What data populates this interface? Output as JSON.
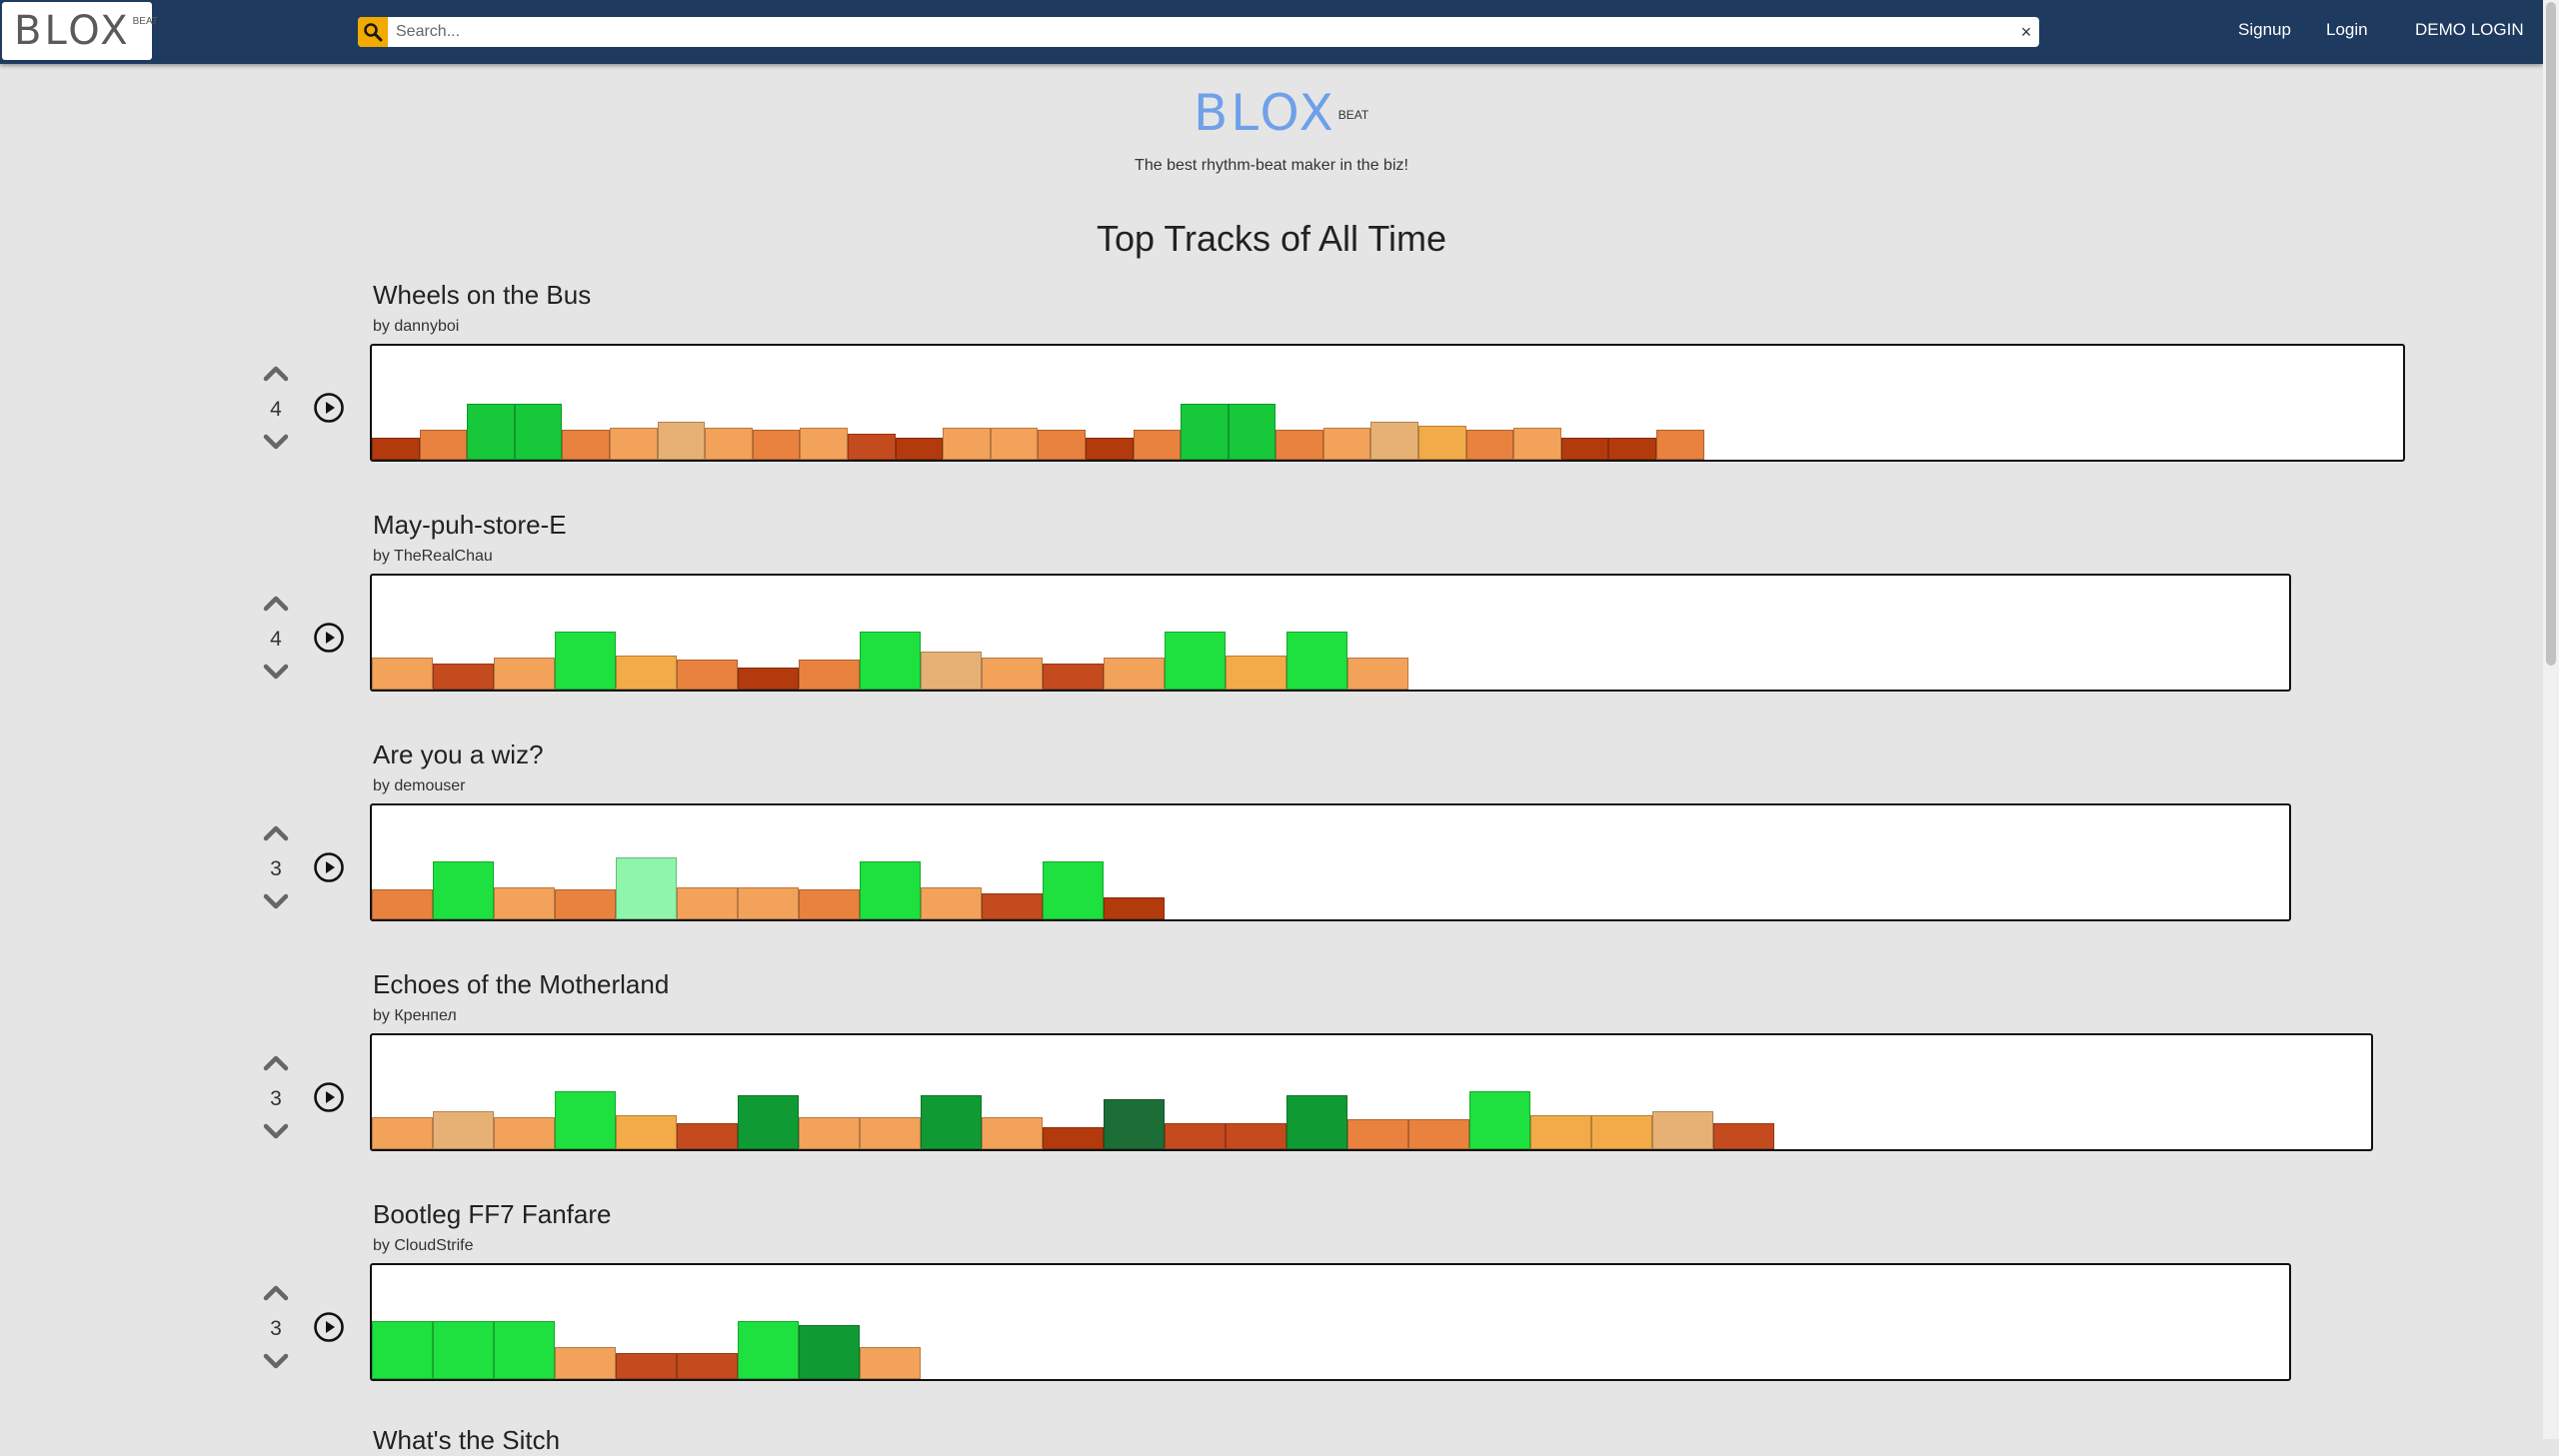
{
  "navbar": {
    "logo_text": "BLOX",
    "logo_sup": "BEAT",
    "search_placeholder": "Search...",
    "search_value": "",
    "clear_label": "×",
    "links": [
      "Signup",
      "Login",
      "DEMO LOGIN"
    ],
    "accent_color": "#f2a900",
    "bar_color": "#1f3a5f"
  },
  "hero": {
    "logo_text": "BLOX",
    "logo_sup": "BEAT",
    "tagline": "The best rhythm-beat maker in the biz!",
    "logo_color": "#6fa0e8"
  },
  "page_title": "Top Tracks of All Time",
  "palette": {
    "r": "#b33a0c",
    "rr": "#c44b1e",
    "o": "#e9823e",
    "l": "#f3a25a",
    "y": "#f2ab48",
    "t": "#e7b175",
    "g": "#17c93a",
    "G": "#1ee03e",
    "d": "#1c6e36",
    "m": "#109a33",
    "p": "#8ef5aa"
  },
  "tracks": [
    {
      "title": "Wheels on the Bus",
      "author": "by dannyboi",
      "votes": "4",
      "blocks": [
        "r",
        "o",
        "g",
        "g",
        "o",
        "l",
        "t",
        "l",
        "o",
        "l",
        "rr",
        "r",
        "l",
        "l",
        "o",
        "r",
        "o",
        "g",
        "g",
        "o",
        "l",
        "t",
        "y",
        "o",
        "l",
        "r",
        "r",
        "o"
      ]
    },
    {
      "title": "May-puh-store-E",
      "author": "by TheRealChau",
      "votes": "4",
      "blocks": [
        "l",
        "rr",
        "l",
        "G",
        "y",
        "o",
        "r",
        "o",
        "G",
        "t",
        "l",
        "rr",
        "l",
        "G",
        "y",
        "G",
        "l"
      ]
    },
    {
      "title": "Are you a wiz?",
      "author": "by demouser",
      "votes": "3",
      "blocks": [
        "o",
        "G",
        "l",
        "o",
        "p",
        "l",
        "l",
        "o",
        "G",
        "l",
        "rr",
        "G",
        "r"
      ]
    },
    {
      "title": "Echoes of the Motherland",
      "author": "by Кренпел",
      "votes": "3",
      "blocks": [
        "l",
        "t",
        "l",
        "G",
        "y",
        "rr",
        "m",
        "l",
        "l",
        "m",
        "l",
        "r",
        "d",
        "rr",
        "rr",
        "m",
        "o",
        "o",
        "G",
        "y",
        "y",
        "t",
        "rr"
      ]
    },
    {
      "title": "Bootleg FF7 Fanfare",
      "author": "by CloudStrife",
      "votes": "3",
      "blocks": [
        "G",
        "G",
        "G",
        "l",
        "rr",
        "rr",
        "G",
        "m",
        "l"
      ]
    }
  ],
  "next_track_title": "What's the Sitch"
}
